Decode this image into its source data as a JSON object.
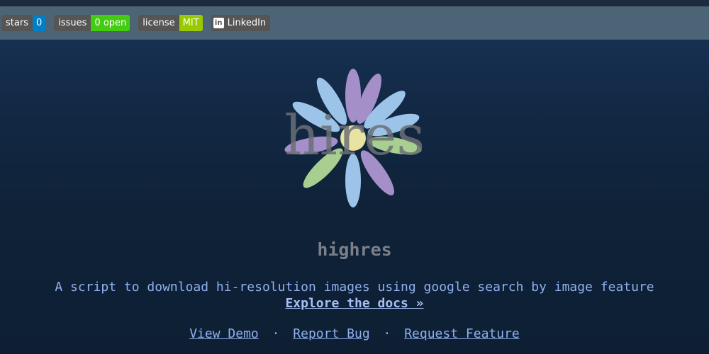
{
  "badges": {
    "stars": {
      "label": "stars",
      "value": "0"
    },
    "issues": {
      "label": "issues",
      "value": "0 open"
    },
    "license": {
      "label": "license",
      "value": "MIT"
    },
    "linkedin": {
      "label": "LinkedIn"
    }
  },
  "logo": {
    "text": "hires"
  },
  "project": {
    "title": "highres",
    "description": "A script to download hi-resolution images using google search by image feature",
    "docs_link": "Explore the docs »"
  },
  "links": {
    "demo": "View Demo",
    "bug": "Report Bug",
    "feature": "Request Feature",
    "separator": "·"
  },
  "colors": {
    "badge_label_bg": "#555555",
    "stars_value_bg": "#007ec6",
    "issues_value_bg": "#44cc11",
    "license_value_bg": "#97ca00",
    "link_color": "#8fb0f0",
    "title_color": "#7a7f88"
  }
}
